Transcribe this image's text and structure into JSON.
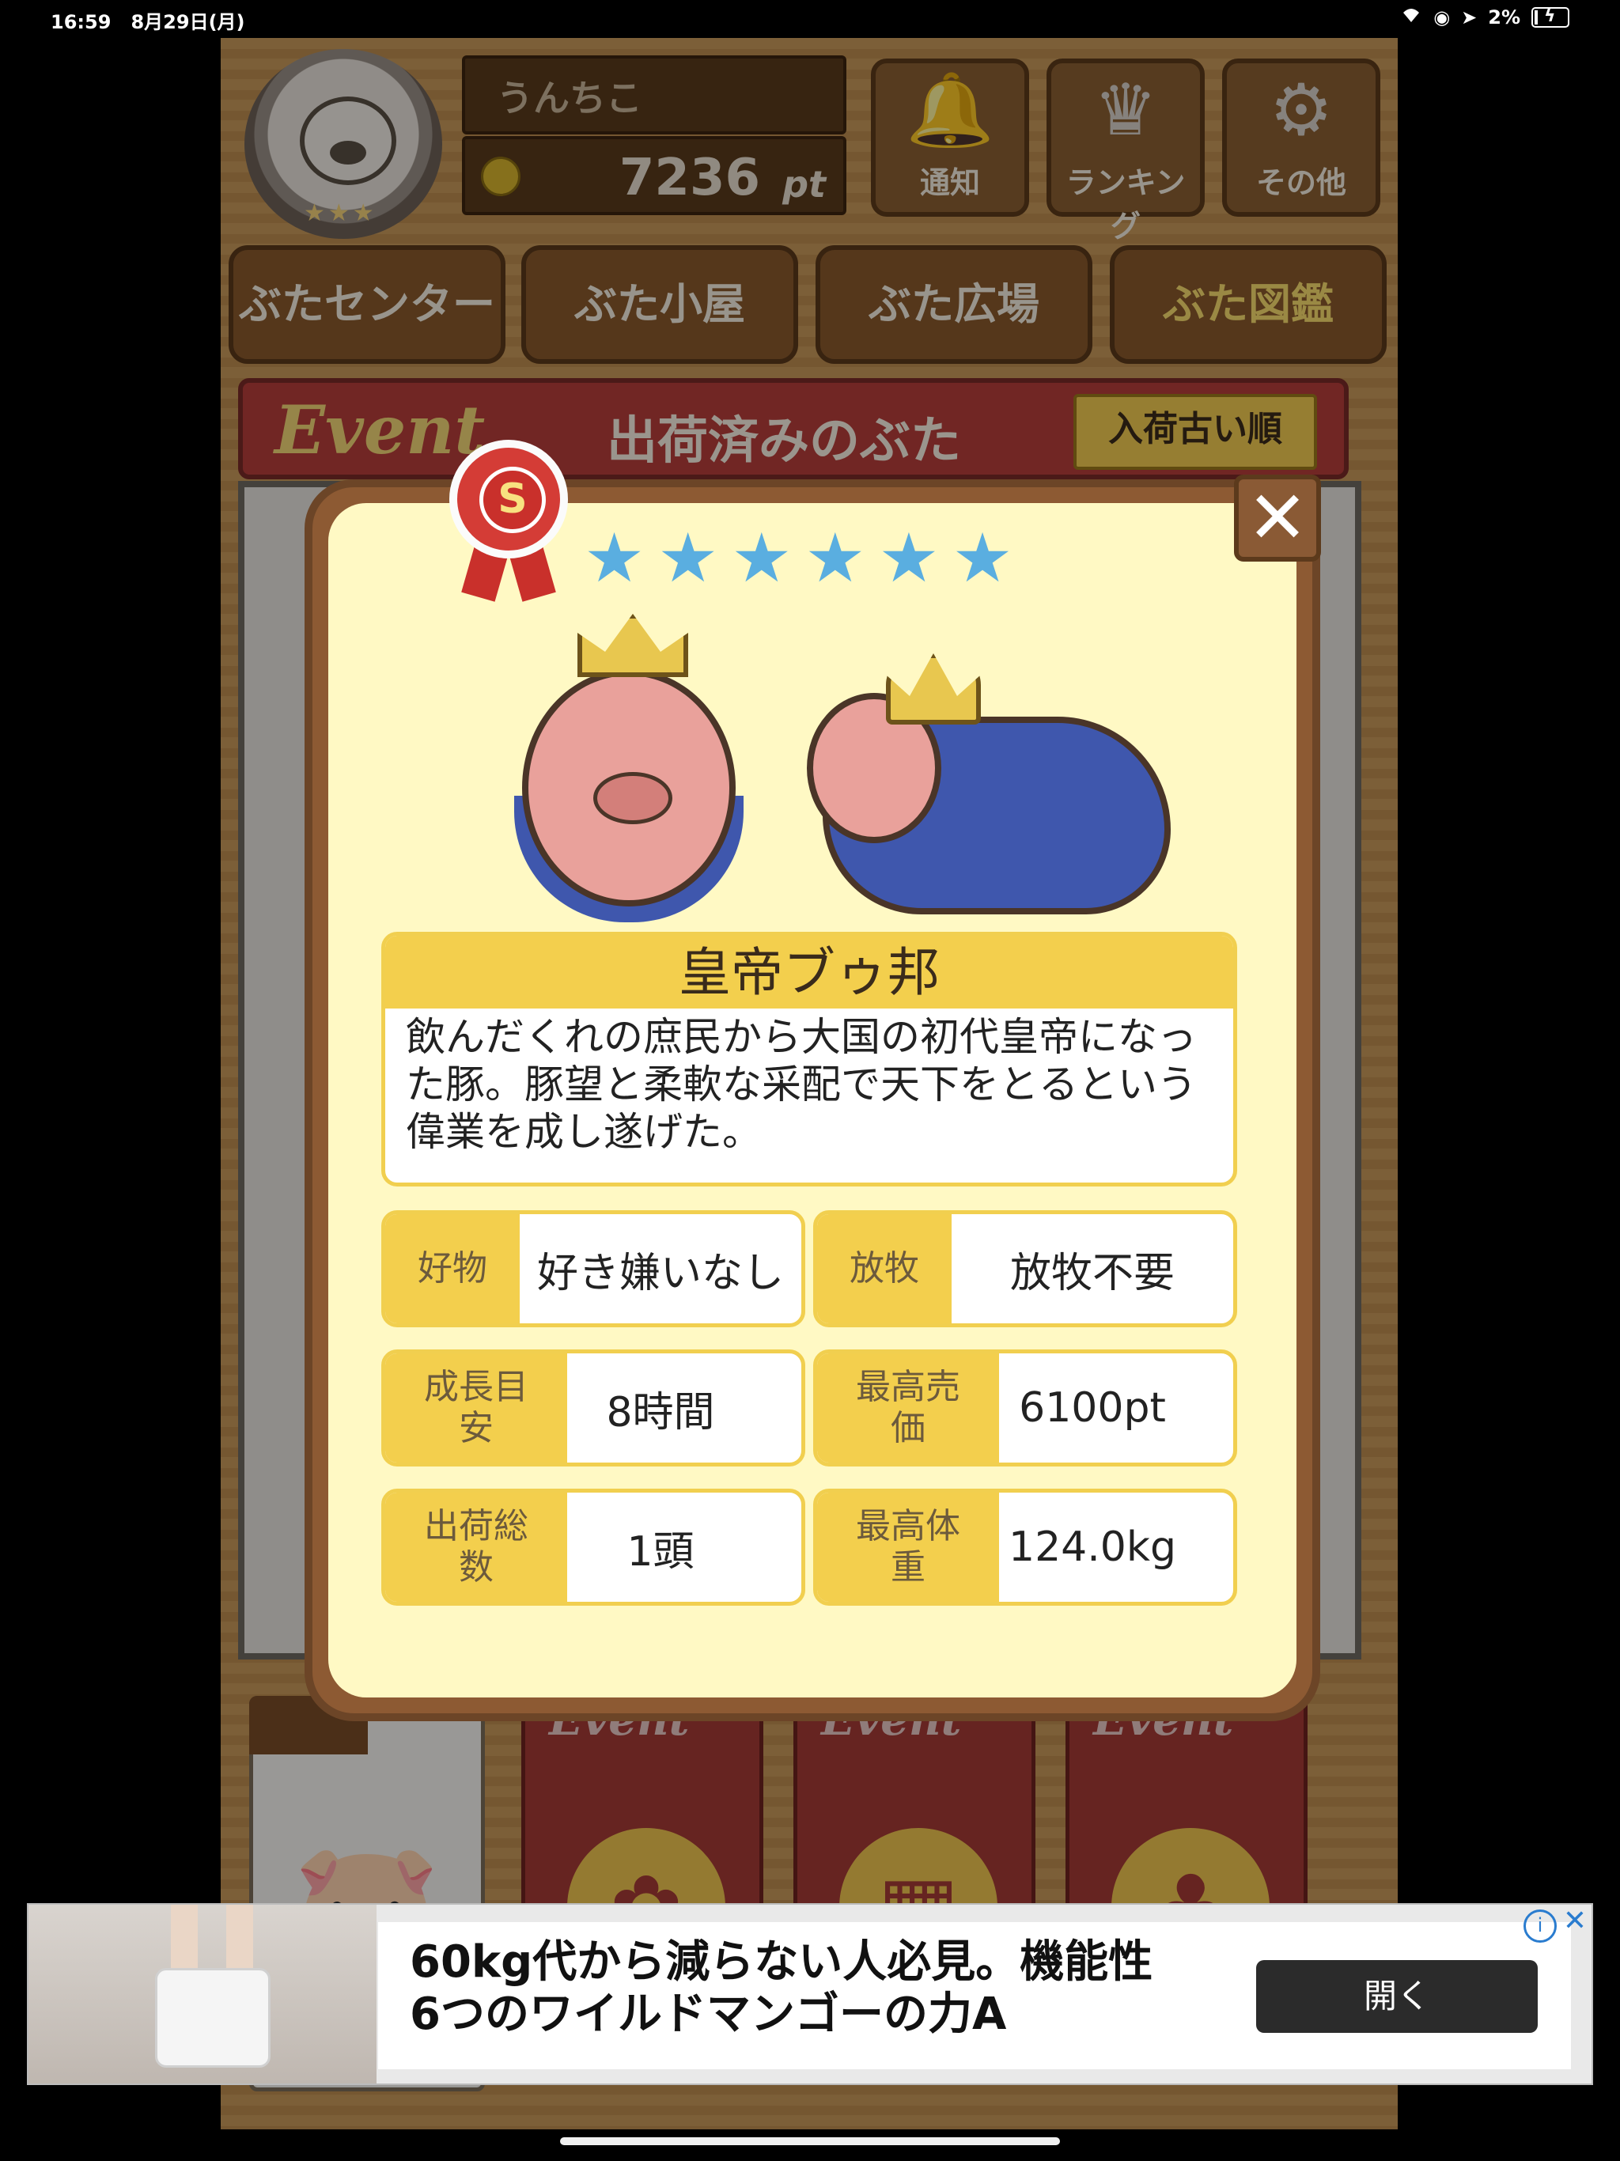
{
  "status_bar": {
    "time": "16:59",
    "date": "8月29日(月)",
    "battery": "2%"
  },
  "header": {
    "username": "うんちこ",
    "points": "7236",
    "points_unit": "pt",
    "buttons": [
      {
        "label": "通知",
        "icon": "bell-icon"
      },
      {
        "label": "ランキング",
        "icon": "crown-icon"
      },
      {
        "label": "その他",
        "icon": "gear-icon"
      }
    ]
  },
  "tabs": [
    "ぶたセンター",
    "ぶた小屋",
    "ぶた広場",
    "ぶた図鑑"
  ],
  "active_tab_index": 3,
  "event_bar": {
    "event_label": "Event",
    "title": "出荷済みのぶた",
    "sort_button": "入荷古い順"
  },
  "bottom_cards": {
    "event_label": "Event"
  },
  "modal": {
    "rank": "S",
    "stars": "★★★★★★",
    "star_count": 6,
    "name": "皇帝ブゥ邦",
    "description": "飲んだくれの庶民から大国の初代皇帝になった豚。豚望と柔軟な采配で天下をとるという偉業を成し遂げた。",
    "stats": [
      {
        "key": "好物",
        "value": "好き嫌いなし"
      },
      {
        "key": "放牧",
        "value": "放牧不要"
      },
      {
        "key": "成長目安",
        "value": "8時間"
      },
      {
        "key": "最高売価",
        "value": "6100pt"
      },
      {
        "key": "出荷総数",
        "value": "1頭"
      },
      {
        "key": "最高体重",
        "value": "124.0kg"
      }
    ],
    "close_label": "✕"
  },
  "ad": {
    "line1": "60kg代から減らない人必見。機能性",
    "line2": "6つのワイルドマンゴーの力A",
    "button": "開く",
    "info": "i",
    "close": "✕"
  },
  "colors": {
    "accent_yellow": "#f3cf4d",
    "modal_bg": "#fff9c4",
    "star_blue": "#5aaee0",
    "event_red": "#b73e3a"
  }
}
